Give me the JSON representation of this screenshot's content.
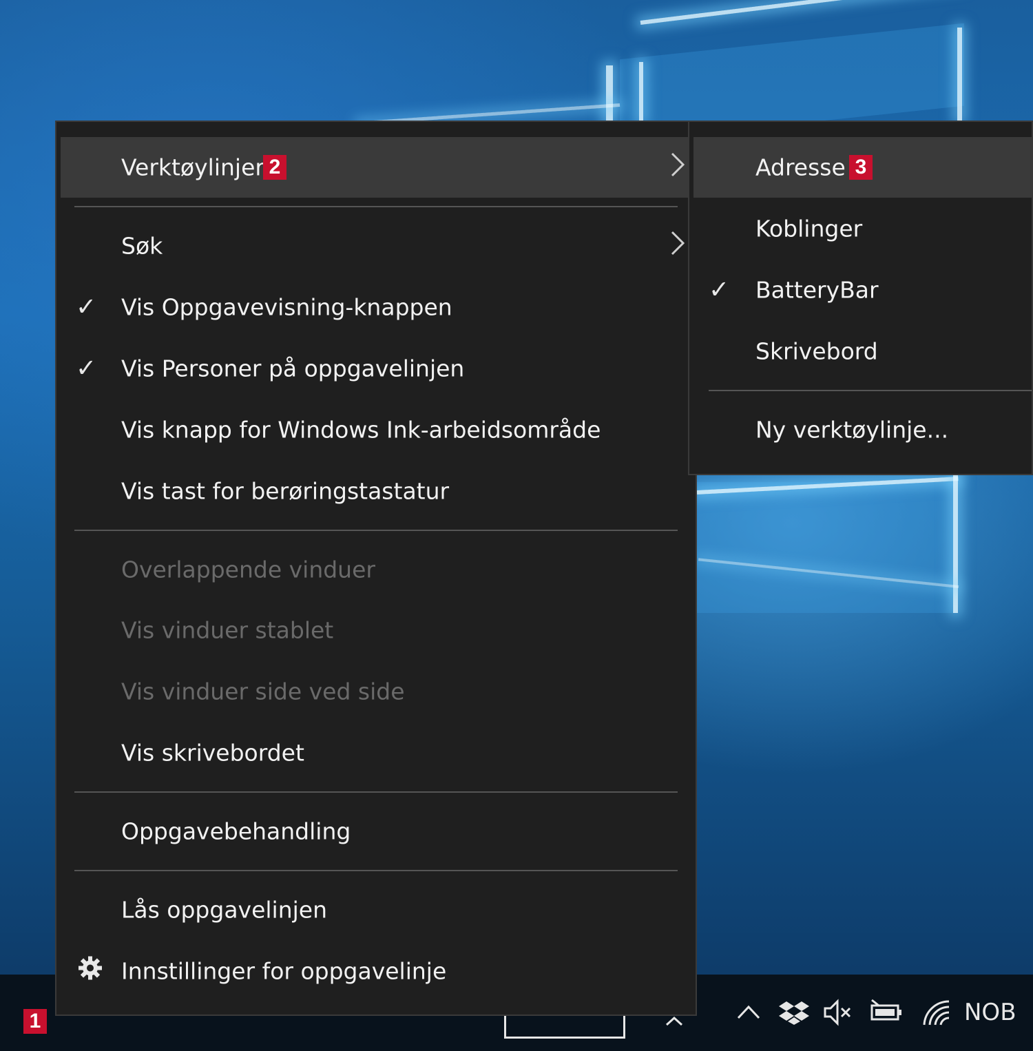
{
  "context_menu": {
    "items": [
      {
        "label": "Verktøylinjer",
        "badge": "2"
      },
      {
        "label": "Søk"
      },
      {
        "label": "Vis Oppgavevisning-knappen",
        "checked": true
      },
      {
        "label": "Vis Personer på oppgavelinjen",
        "checked": true
      },
      {
        "label": "Vis knapp for Windows Ink-arbeidsområde"
      },
      {
        "label": "Vis tast for berøringstastatur"
      },
      {
        "label": "Overlappende vinduer",
        "disabled": true
      },
      {
        "label": "Vis vinduer stablet",
        "disabled": true
      },
      {
        "label": "Vis vinduer side ved side",
        "disabled": true
      },
      {
        "label": "Vis skrivebordet"
      },
      {
        "label": "Oppgavebehandling"
      },
      {
        "label": "Lås oppgavelinjen"
      },
      {
        "label": "Innstillinger for oppgavelinje",
        "icon": "gear-icon"
      }
    ]
  },
  "submenu": {
    "items": [
      {
        "label": "Adresse",
        "badge": "3"
      },
      {
        "label": "Koblinger"
      },
      {
        "label": "BatteryBar",
        "checked": true
      },
      {
        "label": "Skrivebord"
      },
      {
        "label": "Ny verktøylinje..."
      }
    ]
  },
  "taskbar": {
    "badge": "1",
    "language": "NOB",
    "tray_icons": [
      "chevron-up-icon",
      "dropbox-icon",
      "volume-muted-icon",
      "battery-icon",
      "wifi-icon"
    ]
  },
  "colors": {
    "menu_bg": "#1f1f1f",
    "hover_bg": "#3a3a3a",
    "badge_red": "#c8102e",
    "disabled_text": "#6a6a6a"
  }
}
